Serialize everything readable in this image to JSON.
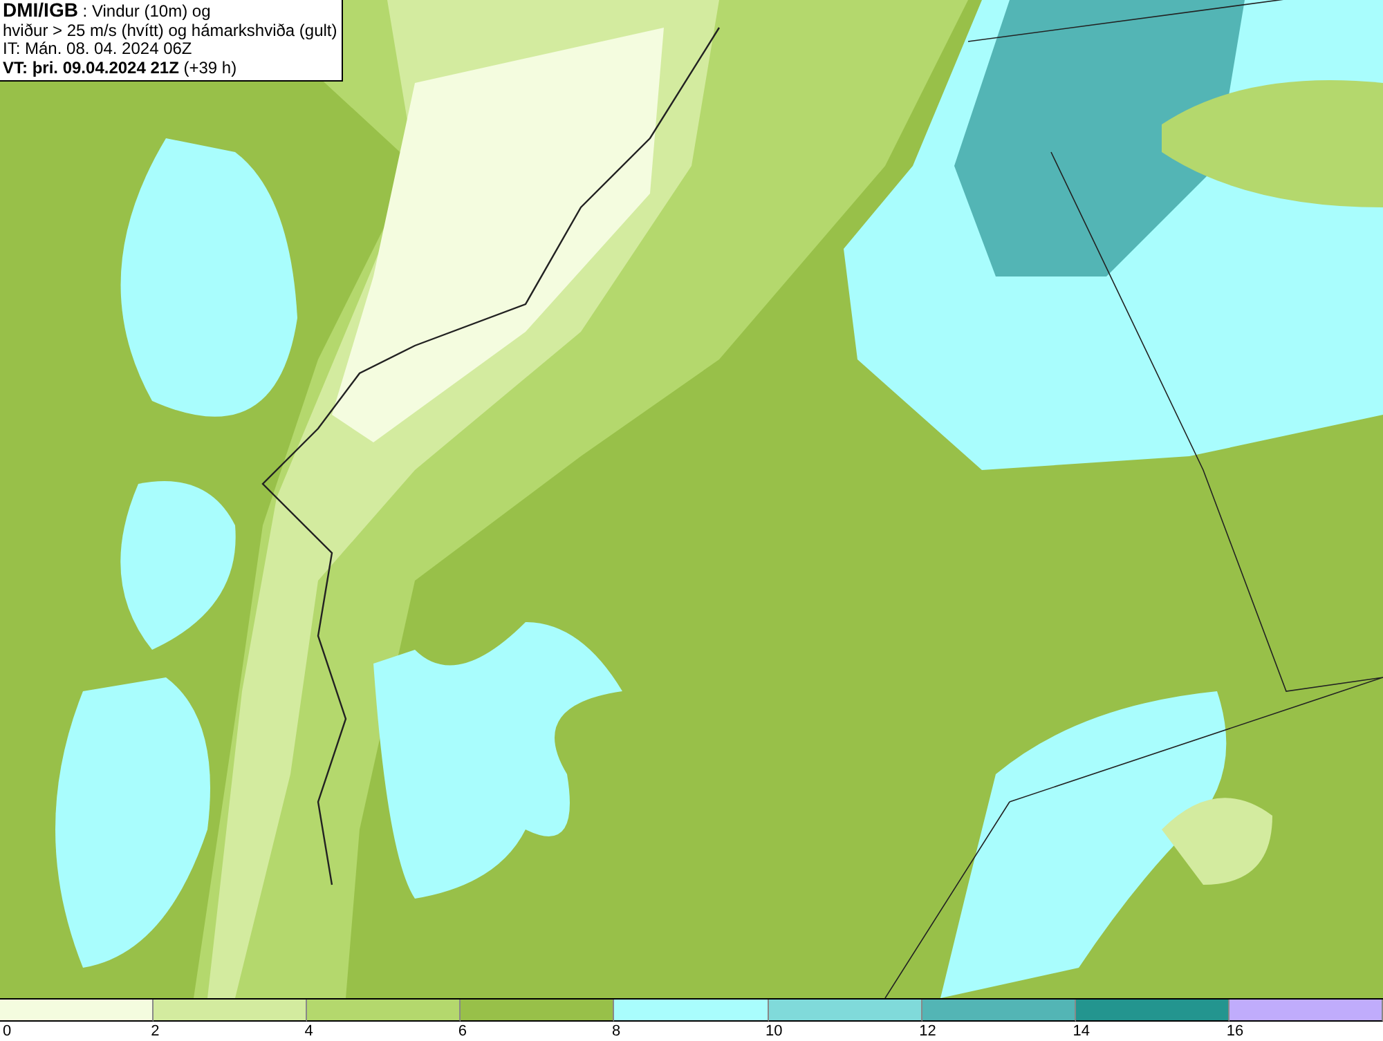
{
  "info_box": {
    "lines": [
      "**DMI/IGB** : Vindur (10m) og",
      "hviður > 25 m/s (hvítt) og hámarkshviða (gult)",
      "IT: Mán. 08. 04. 2024 06Z",
      "**VT: þri. 09.04.2024 21Z** (+39 h)"
    ]
  },
  "legend": {
    "bins": [
      {
        "label": "0",
        "color": "#f4fcdf"
      },
      {
        "label": "2",
        "color": "#d3eb9f"
      },
      {
        "label": "4",
        "color": "#b4d86d"
      },
      {
        "label": "6",
        "color": "#98c049"
      },
      {
        "label": "8",
        "color": "#a9fdfd"
      },
      {
        "label": "10",
        "color": "#80dada"
      },
      {
        "label": "12",
        "color": "#53b5b5"
      },
      {
        "label": "14",
        "color": "#23958f"
      },
      {
        "label": "16",
        "color": "#c0acfc"
      }
    ]
  }
}
